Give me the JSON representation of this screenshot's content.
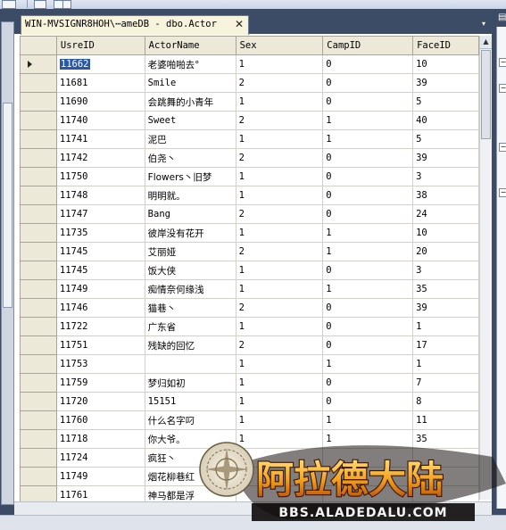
{
  "tab": {
    "title": "WIN-MVSIGNR8HOH\\⋯ameDB - dbo.Actor",
    "close_glyph": "✕"
  },
  "columns": [
    "UsreID",
    "ActorName",
    "Sex",
    "CampID",
    "FaceID"
  ],
  "rows": [
    [
      "11662",
      "老婆啪啪去°",
      "1",
      "0",
      "10"
    ],
    [
      "11681",
      "Smile",
      "2",
      "0",
      "39"
    ],
    [
      "11690",
      "会跳舞的小青年",
      "1",
      "0",
      "5"
    ],
    [
      "11740",
      "Sweet",
      "2",
      "1",
      "40"
    ],
    [
      "11741",
      "泥巴",
      "1",
      "1",
      "5"
    ],
    [
      "11742",
      "伯尧丶",
      "2",
      "0",
      "39"
    ],
    [
      "11750",
      "Flowers丶旧梦",
      "1",
      "0",
      "3"
    ],
    [
      "11748",
      "明明就。",
      "1",
      "0",
      "38"
    ],
    [
      "11747",
      " Bang",
      "2",
      "0",
      "24"
    ],
    [
      "11735",
      "彼岸没有花开",
      "1",
      "1",
      "10"
    ],
    [
      "11745",
      "艾丽娅",
      "2",
      "1",
      "20"
    ],
    [
      "11745",
      "饭大侠",
      "1",
      "0",
      "3"
    ],
    [
      "11749",
      "痴情奈何缘浅",
      "1",
      "1",
      "35"
    ],
    [
      "11746",
      "猫巷丶",
      "2",
      "0",
      "39"
    ],
    [
      "11722",
      "广东省",
      "1",
      "0",
      "1"
    ],
    [
      "11751",
      "残缺的回忆",
      "2",
      "0",
      "17"
    ],
    [
      "11753",
      "",
      "1",
      "1",
      "1"
    ],
    [
      "11759",
      "梦归如初",
      "1",
      "0",
      "7"
    ],
    [
      "11720",
      "15151",
      "1",
      "0",
      "8"
    ],
    [
      "11760",
      "什么名字叼",
      "1",
      "1",
      "11"
    ],
    [
      "11718",
      "你大爷。",
      "1",
      "1",
      "35"
    ],
    [
      "11724",
      "疯狂丶",
      "",
      "",
      ""
    ],
    [
      "11749",
      "烟花柳巷红",
      "",
      "",
      ""
    ],
    [
      "11761",
      "神马都是浮",
      "",
      "",
      ""
    ]
  ],
  "current_row_index": 0,
  "watermark": {
    "logo_text": "阿拉德大陆",
    "url": "BBS.ALADEDALU.COM"
  },
  "colors": {
    "tab_bg": "#f7f3dc",
    "header_bg": "#ede9d8",
    "selection": "#2b58a6",
    "frame": "#3d4c66"
  },
  "icons": [
    "row-pointer-icon",
    "close-icon",
    "collapse-icon"
  ]
}
